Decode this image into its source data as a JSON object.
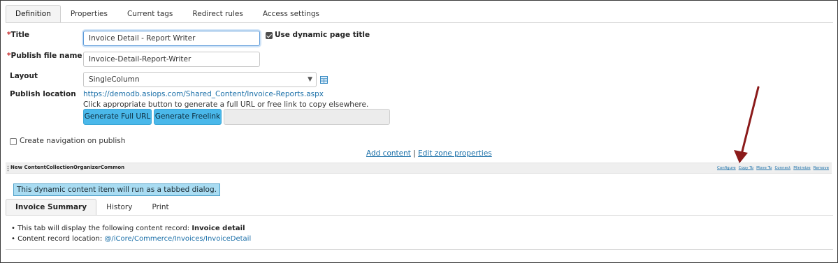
{
  "tabs": [
    "Definition",
    "Properties",
    "Current tags",
    "Redirect rules",
    "Access settings"
  ],
  "form": {
    "title_label": "Title",
    "title_value": "Invoice Detail - Report Writer",
    "dynamic_title_label": "Use dynamic page title",
    "dynamic_title_checked": true,
    "publish_file_label": "Publish file name",
    "publish_file_value": "Invoice-Detail-Report-Writer",
    "layout_label": "Layout",
    "layout_value": "SingleColumn",
    "publish_location_label": "Publish location",
    "publish_location_url": "https://demodb.asiops.com/Shared_Content/Invoice-Reports.aspx",
    "publish_hint": "Click appropriate button to generate a full URL or free link to copy elsewhere.",
    "generate_full_url": "Generate Full URL",
    "generate_freelink": "Generate Freelink",
    "generated_link_value": "",
    "create_nav_label": "Create navigation on publish",
    "create_nav_checked": false
  },
  "content_links": {
    "add_content": "Add content",
    "separator": "|",
    "edit_zone": "Edit zone properties"
  },
  "zone": {
    "title": "New ContentCollectionOrganizerCommon",
    "actions": [
      "Configure",
      "Copy To",
      "Move To",
      "Connect",
      "Minimize",
      "Remove"
    ]
  },
  "notice": "This dynamic content item will run as a tabbed dialog.",
  "inner_tabs": [
    "Invoice Summary",
    "History",
    "Print"
  ],
  "details": {
    "line1_prefix": "• This tab will display the following content record: ",
    "line1_record": "Invoice detail",
    "line2_prefix": "• Content record location: ",
    "line2_path": "@/iCore/Commerce/Invoices/InvoiceDetail"
  },
  "colors": {
    "accent_button": "#4ab8ea",
    "link": "#1a6fa8",
    "arrow": "#8b1a1a",
    "notice_bg": "#a9dcf2"
  },
  "icons": {
    "layout_preview": "layout-grid-icon",
    "select_chevron": "chevron-down-icon",
    "annotation": "arrow-annotation"
  }
}
